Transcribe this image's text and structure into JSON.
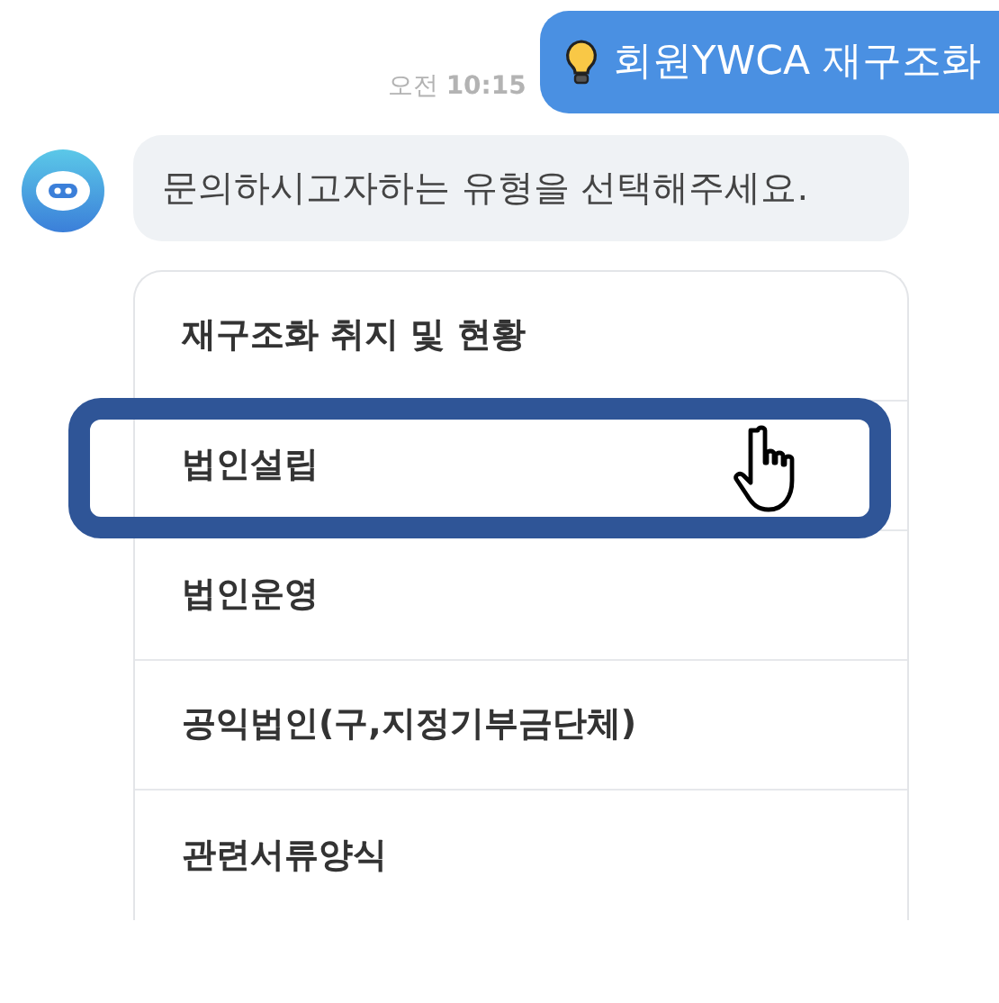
{
  "user_message": {
    "text": "회원YWCA 재구조화",
    "time_prefix": "오전",
    "time": "10:15"
  },
  "bot_message": {
    "text": "문의하시고자하는 유형을 선택해주세요."
  },
  "options": [
    {
      "label": "재구조화 취지 및 현황",
      "selected": false
    },
    {
      "label": "법인설립",
      "selected": true
    },
    {
      "label": "법인운영",
      "selected": false
    },
    {
      "label": "공익법인(구,지정기부금단체)",
      "selected": false
    },
    {
      "label": "관련서류양식",
      "selected": false
    }
  ]
}
